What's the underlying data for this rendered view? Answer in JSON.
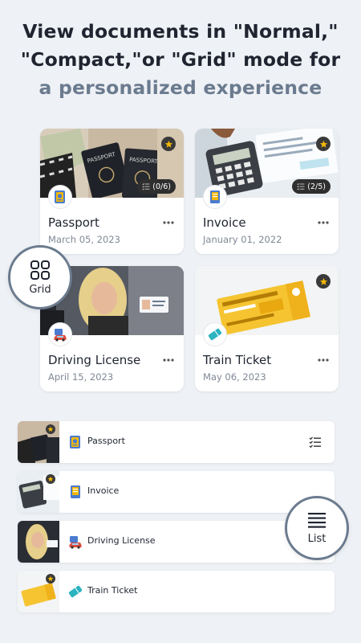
{
  "headline": {
    "line1": "View documents in \"Normal,\"",
    "line2": "\"Compact,\"or \"Grid\" mode for",
    "line3": "a personalized experience"
  },
  "grid_cards": [
    {
      "title": "Passport",
      "date": "March 05, 2023",
      "count": "(0/6)",
      "icon": "passport-icon",
      "starred": true
    },
    {
      "title": "Invoice",
      "date": "January 01, 2022",
      "count": "(2/5)",
      "icon": "invoice-icon",
      "starred": true
    },
    {
      "title": "Driving License",
      "date": "April 15, 2023",
      "icon": "car-icon",
      "starred": false
    },
    {
      "title": "Train Ticket",
      "date": "May 06, 2023",
      "icon": "ticket-icon",
      "starred": true
    }
  ],
  "grid_button": {
    "label": "Grid",
    "icon": "grid-icon"
  },
  "list_button": {
    "label": "List",
    "icon": "list-icon"
  },
  "list_rows": [
    {
      "title": "Passport",
      "icon": "passport-icon",
      "starred": true
    },
    {
      "title": "Invoice",
      "icon": "invoice-icon",
      "starred": true
    },
    {
      "title": "Driving License",
      "icon": "car-icon",
      "starred": false
    },
    {
      "title": "Train Ticket",
      "icon": "ticket-icon",
      "starred": true
    }
  ],
  "colors": {
    "background": "#eef1f5",
    "heading": "#1f2430",
    "accent": "#6b7b8f",
    "star": "#f2b705"
  }
}
